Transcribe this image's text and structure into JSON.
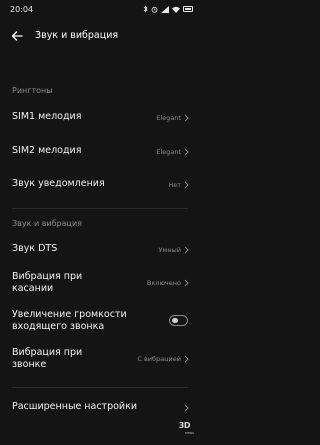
{
  "status_bar": {
    "time": "20:04",
    "indicators": [
      "bluetooth-icon",
      "alarm-icon",
      "wifi-icon",
      "signal-icon",
      "battery-icon"
    ]
  },
  "header": {
    "title": "Звук и вибрация",
    "back_icon": "arrow-left-icon"
  },
  "sections": {
    "ringtones": {
      "header": "Рингтоны",
      "items": [
        {
          "label": "SIM1 мелодия",
          "value": "Elegant"
        },
        {
          "label": "SIM2 мелодия",
          "value": "Elegant"
        },
        {
          "label": "Звук уведомления",
          "value": "Нет"
        }
      ]
    },
    "sound_vibration": {
      "header": "Звук и вибрация",
      "items": [
        {
          "label": "Звук DTS",
          "value": "Умный"
        },
        {
          "label_line1": "Вибрация при",
          "label_line2": "касании",
          "value": "Включено"
        },
        {
          "label_line1": "Увеличение громкости",
          "label_line2": "входящего звонка",
          "toggle_on": false
        },
        {
          "label_line1": "Вибрация при",
          "label_line2": "звонке",
          "value": "С вибрацией"
        }
      ]
    }
  },
  "advanced": {
    "label": "Расширенные настройки"
  },
  "watermark": {
    "logo": "3D",
    "text": "news"
  },
  "colors": {
    "background": "#141414",
    "text_primary": "#f2f2f2",
    "text_secondary": "#8a8a8a",
    "divider": "#2a2a2a"
  }
}
